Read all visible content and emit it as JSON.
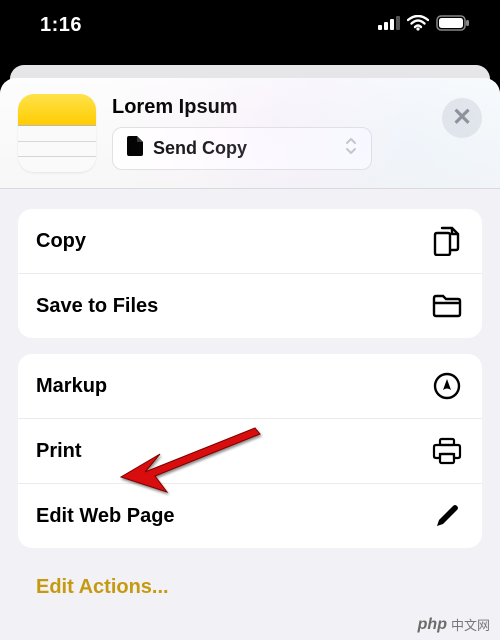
{
  "status": {
    "time": "1:16"
  },
  "header": {
    "title": "Lorem Ipsum",
    "send_copy_label": "Send Copy"
  },
  "groups": [
    {
      "items": [
        {
          "id": "copy",
          "label": "Copy",
          "icon": "duplicate-icon"
        },
        {
          "id": "save-to-files",
          "label": "Save to Files",
          "icon": "folder-icon"
        }
      ]
    },
    {
      "items": [
        {
          "id": "markup",
          "label": "Markup",
          "icon": "markup-icon"
        },
        {
          "id": "print",
          "label": "Print",
          "icon": "printer-icon"
        },
        {
          "id": "edit-web-page",
          "label": "Edit Web Page",
          "icon": "pencil-icon"
        }
      ]
    }
  ],
  "footer": {
    "edit_actions": "Edit Actions..."
  },
  "watermark": {
    "brand": "php",
    "text": "中文网"
  }
}
